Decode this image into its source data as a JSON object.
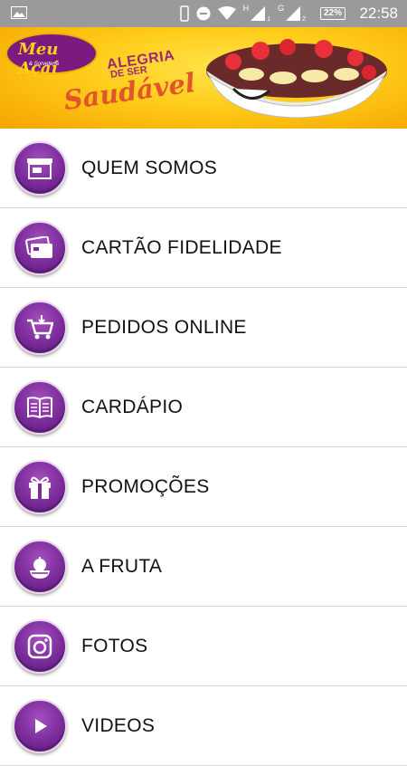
{
  "status_bar": {
    "time": "22:58",
    "battery": "22%",
    "net_h": "H",
    "net_g": "G",
    "sim1": "1",
    "sim2": "2"
  },
  "banner": {
    "logo_text": "Meu Açaí",
    "logo_sub": "& Sorveteria",
    "tagline_1": "ALEGRIA",
    "tagline_2": "DE SER",
    "tagline_3": "Saudável"
  },
  "menu": {
    "items": [
      {
        "label": "QUEM SOMOS",
        "icon": "store-icon"
      },
      {
        "label": "CARTÃO FIDELIDADE",
        "icon": "credit-card-icon"
      },
      {
        "label": "PEDIDOS ONLINE",
        "icon": "shopping-cart-icon"
      },
      {
        "label": "CARDÁPIO",
        "icon": "menu-book-icon"
      },
      {
        "label": "PROMOÇÕES",
        "icon": "gift-icon"
      },
      {
        "label": "A FRUTA",
        "icon": "fruit-bowl-icon"
      },
      {
        "label": "FOTOS",
        "icon": "camera-icon"
      },
      {
        "label": "VIDEOS",
        "icon": "video-icon"
      }
    ]
  },
  "colors": {
    "icon_purple": "#7a2b9a",
    "banner_yellow": "#ffcc1a",
    "status_bar": "#9a9a9a"
  }
}
